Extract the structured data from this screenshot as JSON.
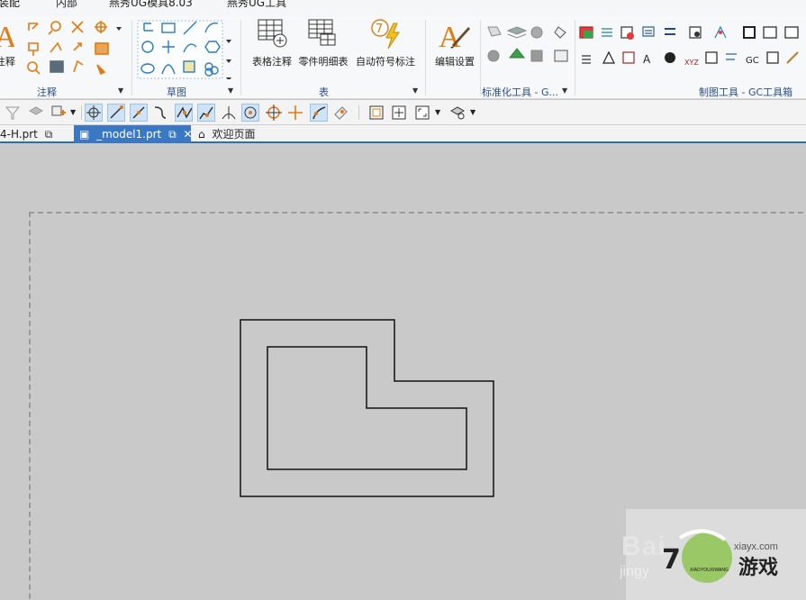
{
  "menubar": {
    "tabs": [
      "装配",
      "内部",
      "燕秀UG模具8.03",
      "燕秀UG工具"
    ]
  },
  "ribbon": {
    "groups": {
      "annotation": "注释",
      "sketch": "草图",
      "table": "表",
      "std_tools": "标准化工具 - G...",
      "gc_tools": "制图工具 - GC工具箱"
    },
    "buttons": {
      "note": "注释",
      "tabular_note": "表格注释",
      "parts_list": "零件明细表",
      "auto_balloon": "自动符号标注",
      "edit_settings": "编辑设置"
    },
    "icon_labels": {
      "xyz": "XYZ",
      "gc": "GC"
    }
  },
  "doc_tabs": [
    {
      "label": "4-H.prt",
      "active": false
    },
    {
      "label": "_model1.prt",
      "active": true
    },
    {
      "label": "欢迎页面",
      "active": false
    }
  ],
  "watermark": {
    "baidu": "Bai",
    "jingyan": "jingy",
    "url": "xiayx.com",
    "game": "游戏",
    "sub": "XIAOYOUXIWANG"
  },
  "colors": {
    "accent": "#3a78c3",
    "canvas": "#c9c9c9",
    "group_label": "#2a4f8a"
  }
}
